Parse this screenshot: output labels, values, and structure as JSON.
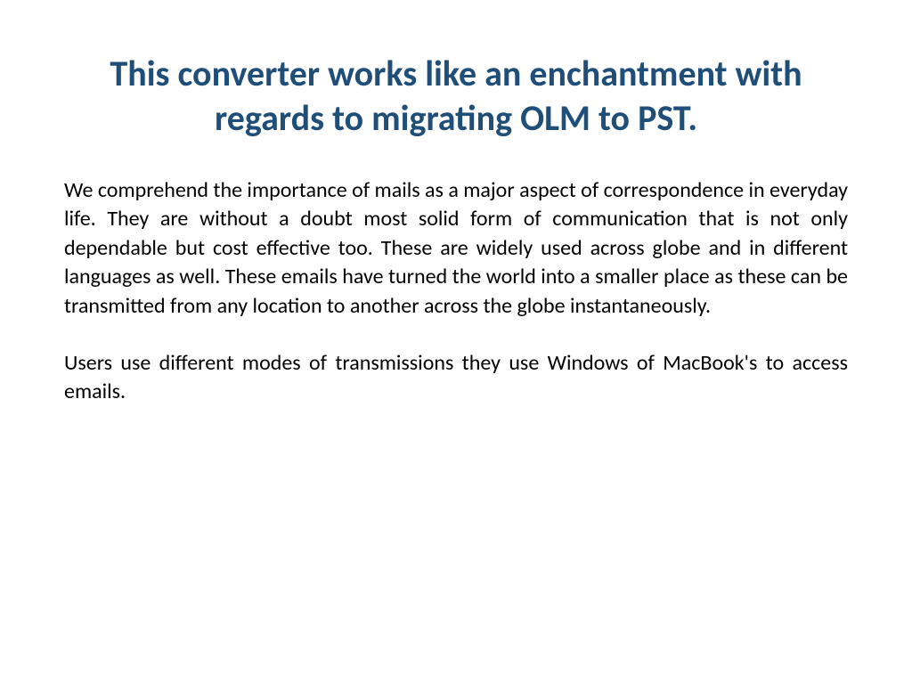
{
  "title": "This converter works like an enchantment with regards to migrating OLM to PST.",
  "paragraph1": "We comprehend the importance of mails as a major aspect of correspondence in everyday life. They are without a doubt most solid form of communication that is not only dependable but cost effective too. These are widely used across globe and in different languages as well. These emails have turned the world into a smaller place as these can be transmitted from any location to another across the globe instantaneously.",
  "paragraph2": "Users use different modes of transmissions they use Windows of MacBook's to access emails."
}
